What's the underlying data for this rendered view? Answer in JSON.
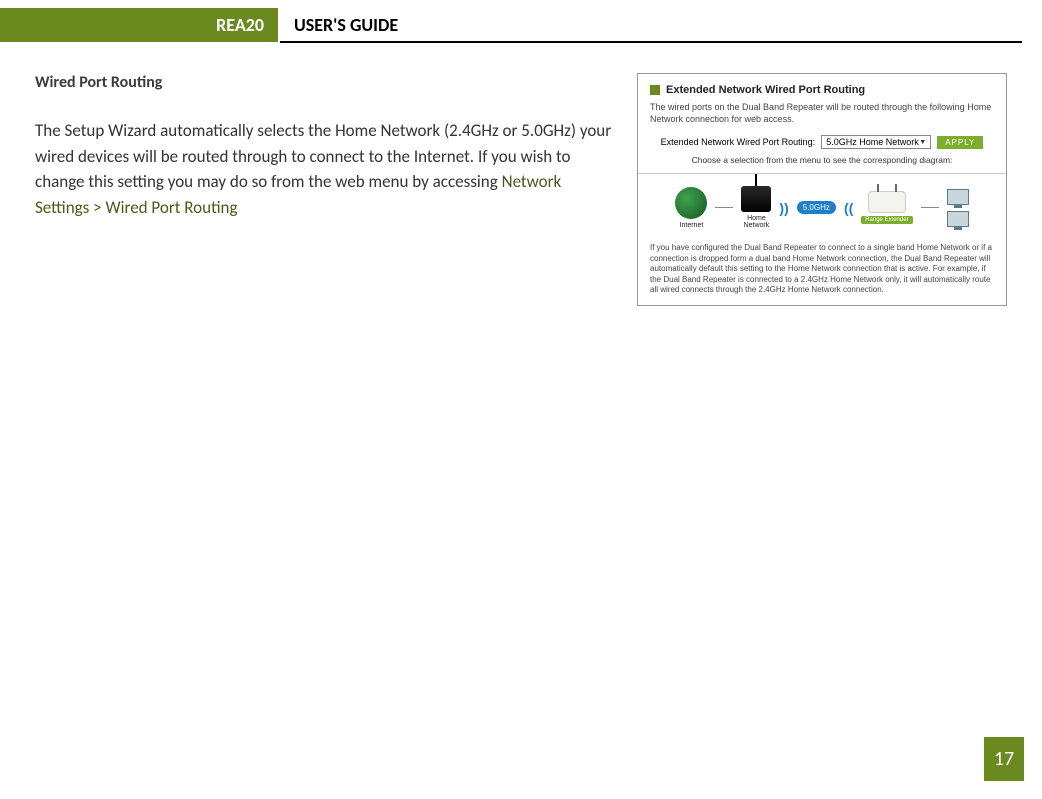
{
  "header": {
    "model": "REA20",
    "title": "USER'S GUIDE"
  },
  "section": {
    "heading": "Wired Port Routing",
    "body_main": "The Setup Wizard automatically selects the Home Network (2.4GHz or 5.0GHz) your wired devices will be routed through to connect to the Internet. If you wish to change this setting you may do so from the web menu by accessing ",
    "body_accent": "Network Settings > Wired Port Routing"
  },
  "screenshot": {
    "title": "Extended Network Wired Port Routing",
    "desc": "The wired ports on the Dual Band Repeater will be routed through the following Home Network connection for web access.",
    "form_label": "Extended Network Wired Port Routing:",
    "select_value": "5.0GHz Home Network",
    "apply": "APPLY",
    "subtext": "Choose a selection from the menu to see the corresponding diagram:",
    "diagram": {
      "internet": "Internet",
      "home": "Home\nNetwork",
      "band": "5.0GHz",
      "extender": "Range Extender"
    },
    "footer": "If you have configured the Dual Band Repeater to connect to a single band Home Network or if a connection is dropped form a dual band Home Network connection, the Dual Band Repeater will automatically default this setting to the Home Network connection that is active. For example, if the Dual Band Repeater is connected to a 2.4GHz Home Network only, it will automatically route all wired connects through the 2.4GHz Home Network connection."
  },
  "page_number": "17"
}
